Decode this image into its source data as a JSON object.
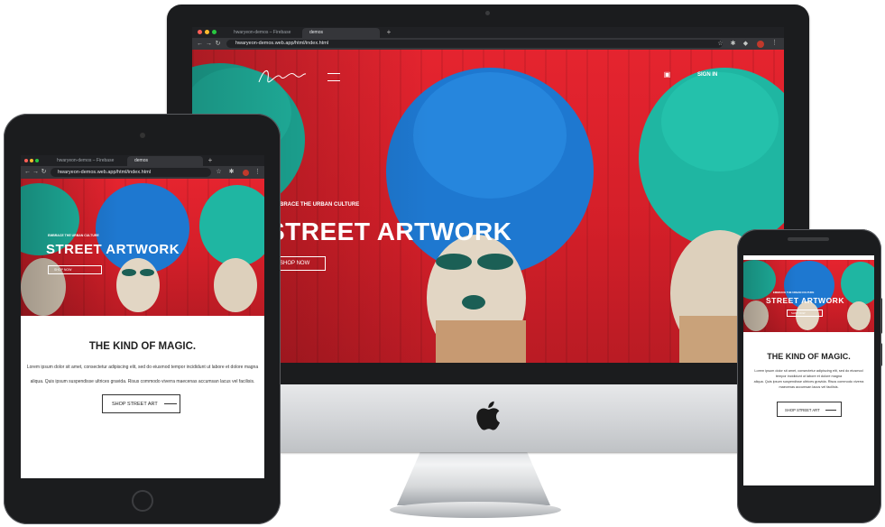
{
  "colors": {
    "hero_red": "#d8232c",
    "flower_teal": "#1fb6a2",
    "flower_blue": "#1e78d0",
    "chrome_dark": "#202124",
    "chrome_mid": "#35363a"
  },
  "browser": {
    "tab1_label": "hwaryeon-demos – Firebase",
    "tab2_label": "demos",
    "url": "hwaryeon-demos.web.app/html/index.html",
    "tab_close": "×",
    "new_tab": "+"
  },
  "hero": {
    "subtitle": "EMBRACE THE URBAN CULTURE",
    "title": "STREET ARTWORK",
    "cta_label": "SHOP NOW",
    "signin_label": "SIGN IN"
  },
  "content": {
    "heading": "THE KIND OF MAGIC.",
    "paragraph_line1": "Lorem ipsum dolor sit amet, consectetur adipiscing elit, sed do eiusmod tempor incididunt ut labore et dolore magna",
    "paragraph_line2": "aliqua. Quis ipsum suspendisse ultrices gravida. Risus commodo viverra maecenas accumsan lacus vel facilisis.",
    "shop_button_label": "SHOP STREET ART"
  },
  "icons": [
    "apple-logo-icon",
    "signature-logo-icon",
    "hamburger-menu-icon",
    "cart-icon",
    "back-arrow-icon",
    "forward-arrow-icon",
    "reload-icon",
    "lock-icon",
    "star-icon",
    "extension-icon"
  ]
}
